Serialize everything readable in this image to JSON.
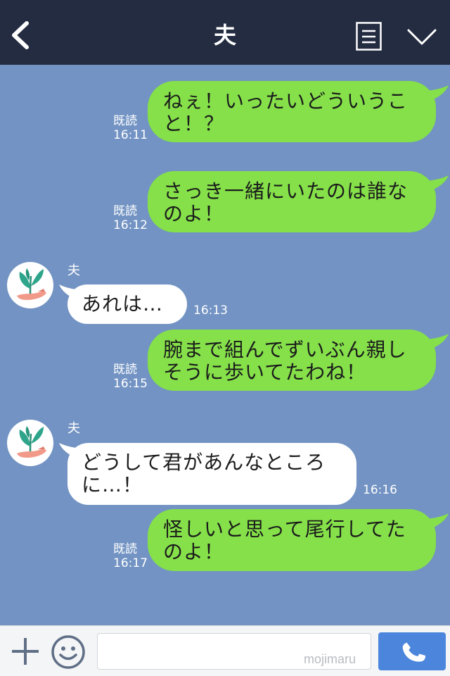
{
  "header": {
    "title": "夫"
  },
  "colors": {
    "header_bg": "#242c42",
    "chat_bg": "#7293c3",
    "outgoing_bubble": "#85e04a",
    "incoming_bubble": "#ffffff",
    "call_button": "#4c86dc"
  },
  "messages": [
    {
      "direction": "out",
      "read": "既読",
      "time": "16:11",
      "line1": "ねぇ！いったいどういうこ",
      "line2": "と！？"
    },
    {
      "direction": "out",
      "read": "既読",
      "time": "16:12",
      "line1": "さっき一緒にいたのは誰な",
      "line2": "のよ！"
    },
    {
      "direction": "in",
      "sender": "夫",
      "time": "16:13",
      "line1": "あれは…"
    },
    {
      "direction": "out",
      "read": "既読",
      "time": "16:15",
      "line1": "腕まで組んでずいぶん親し",
      "line2": "そうに歩いてたわね！"
    },
    {
      "direction": "in",
      "sender": "夫",
      "time": "16:16",
      "line1": "どうして君があんなところ",
      "line2": "に…！"
    },
    {
      "direction": "out",
      "read": "既読",
      "time": "16:17",
      "line1": "怪しいと思って尾行してた",
      "line2": "のよ！"
    }
  ],
  "input": {
    "value": "",
    "watermark": "mojimaru"
  },
  "icons": {
    "back": "chevron-left-icon",
    "menu": "menu-list-icon",
    "collapse": "chevron-down-icon",
    "add": "plus-icon",
    "emoji": "smiley-icon",
    "call": "phone-icon",
    "avatar": "plant-in-hand-icon"
  }
}
